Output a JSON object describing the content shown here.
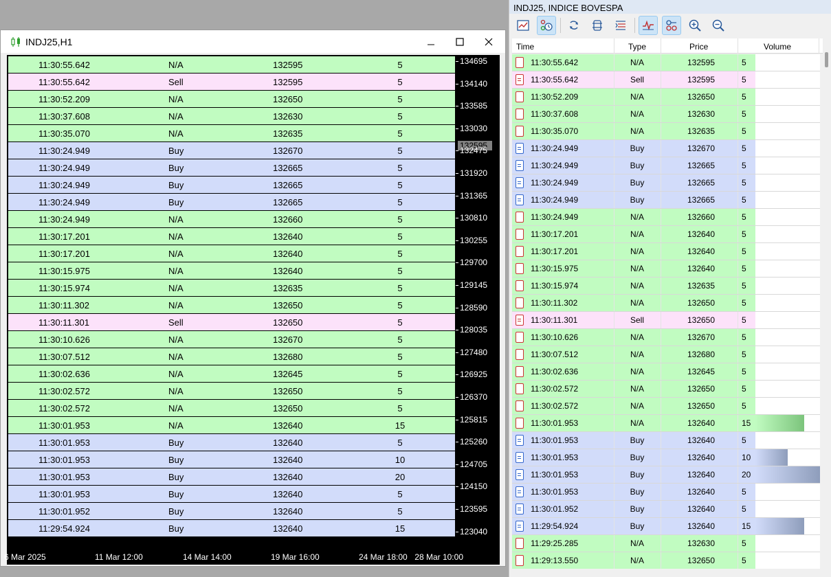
{
  "chart_window": {
    "title": "INDJ25,H1",
    "price_ticks": [
      "134695",
      "134140",
      "133585",
      "133030",
      "132475",
      "131920",
      "131365",
      "130810",
      "130255",
      "129700",
      "129145",
      "128590",
      "128035",
      "127480",
      "126925",
      "126370",
      "125815",
      "125260",
      "124705",
      "124150",
      "123595",
      "123040"
    ],
    "current_price": "132595",
    "time_ticks": [
      "6 Mar 2025",
      "11 Mar 12:00",
      "14 Mar 14:00",
      "19 Mar 16:00",
      "24 Mar 18:00",
      "28 Mar 10:00"
    ],
    "rows": [
      {
        "time": "11:30:55.642",
        "type": "N/A",
        "price": "132595",
        "volume": "5"
      },
      {
        "time": "11:30:55.642",
        "type": "Sell",
        "price": "132595",
        "volume": "5"
      },
      {
        "time": "11:30:52.209",
        "type": "N/A",
        "price": "132650",
        "volume": "5"
      },
      {
        "time": "11:30:37.608",
        "type": "N/A",
        "price": "132630",
        "volume": "5"
      },
      {
        "time": "11:30:35.070",
        "type": "N/A",
        "price": "132635",
        "volume": "5"
      },
      {
        "time": "11:30:24.949",
        "type": "Buy",
        "price": "132670",
        "volume": "5"
      },
      {
        "time": "11:30:24.949",
        "type": "Buy",
        "price": "132665",
        "volume": "5"
      },
      {
        "time": "11:30:24.949",
        "type": "Buy",
        "price": "132665",
        "volume": "5"
      },
      {
        "time": "11:30:24.949",
        "type": "Buy",
        "price": "132665",
        "volume": "5"
      },
      {
        "time": "11:30:24.949",
        "type": "N/A",
        "price": "132660",
        "volume": "5"
      },
      {
        "time": "11:30:17.201",
        "type": "N/A",
        "price": "132640",
        "volume": "5"
      },
      {
        "time": "11:30:17.201",
        "type": "N/A",
        "price": "132640",
        "volume": "5"
      },
      {
        "time": "11:30:15.975",
        "type": "N/A",
        "price": "132640",
        "volume": "5"
      },
      {
        "time": "11:30:15.974",
        "type": "N/A",
        "price": "132635",
        "volume": "5"
      },
      {
        "time": "11:30:11.302",
        "type": "N/A",
        "price": "132650",
        "volume": "5"
      },
      {
        "time": "11:30:11.301",
        "type": "Sell",
        "price": "132650",
        "volume": "5"
      },
      {
        "time": "11:30:10.626",
        "type": "N/A",
        "price": "132670",
        "volume": "5"
      },
      {
        "time": "11:30:07.512",
        "type": "N/A",
        "price": "132680",
        "volume": "5"
      },
      {
        "time": "11:30:02.636",
        "type": "N/A",
        "price": "132645",
        "volume": "5"
      },
      {
        "time": "11:30:02.572",
        "type": "N/A",
        "price": "132650",
        "volume": "5"
      },
      {
        "time": "11:30:02.572",
        "type": "N/A",
        "price": "132650",
        "volume": "5"
      },
      {
        "time": "11:30:01.953",
        "type": "N/A",
        "price": "132640",
        "volume": "15"
      },
      {
        "time": "11:30:01.953",
        "type": "Buy",
        "price": "132640",
        "volume": "5"
      },
      {
        "time": "11:30:01.953",
        "type": "Buy",
        "price": "132640",
        "volume": "10"
      },
      {
        "time": "11:30:01.953",
        "type": "Buy",
        "price": "132640",
        "volume": "20"
      },
      {
        "time": "11:30:01.953",
        "type": "Buy",
        "price": "132640",
        "volume": "5"
      },
      {
        "time": "11:30:01.952",
        "type": "Buy",
        "price": "132640",
        "volume": "5"
      },
      {
        "time": "11:29:54.924",
        "type": "Buy",
        "price": "132640",
        "volume": "15"
      }
    ]
  },
  "ts_window": {
    "title": "INDJ25, INDICE BOVESPA",
    "toolbar": [
      "chart-icon",
      "ticks-clock-icon",
      "sync-icon",
      "columns-icon",
      "list-icon",
      "pulse-icon",
      "circles-icon",
      "zoom-in-icon",
      "zoom-out-icon"
    ],
    "headers": {
      "time": "Time",
      "type": "Type",
      "price": "Price",
      "volume": "Volume"
    },
    "max_volume": 20,
    "colors": {
      "na": "#c1fcc1",
      "buy": "#d2dcfa",
      "sell": "#fce2fa",
      "na_bar": "#7cc47c",
      "buy_bar": "#8e9dbb"
    },
    "rows": [
      {
        "time": "11:30:55.642",
        "type": "N/A",
        "price": "132595",
        "volume": "5"
      },
      {
        "time": "11:30:55.642",
        "type": "Sell",
        "price": "132595",
        "volume": "5"
      },
      {
        "time": "11:30:52.209",
        "type": "N/A",
        "price": "132650",
        "volume": "5"
      },
      {
        "time": "11:30:37.608",
        "type": "N/A",
        "price": "132630",
        "volume": "5"
      },
      {
        "time": "11:30:35.070",
        "type": "N/A",
        "price": "132635",
        "volume": "5"
      },
      {
        "time": "11:30:24.949",
        "type": "Buy",
        "price": "132670",
        "volume": "5"
      },
      {
        "time": "11:30:24.949",
        "type": "Buy",
        "price": "132665",
        "volume": "5"
      },
      {
        "time": "11:30:24.949",
        "type": "Buy",
        "price": "132665",
        "volume": "5"
      },
      {
        "time": "11:30:24.949",
        "type": "Buy",
        "price": "132665",
        "volume": "5"
      },
      {
        "time": "11:30:24.949",
        "type": "N/A",
        "price": "132660",
        "volume": "5"
      },
      {
        "time": "11:30:17.201",
        "type": "N/A",
        "price": "132640",
        "volume": "5"
      },
      {
        "time": "11:30:17.201",
        "type": "N/A",
        "price": "132640",
        "volume": "5"
      },
      {
        "time": "11:30:15.975",
        "type": "N/A",
        "price": "132640",
        "volume": "5"
      },
      {
        "time": "11:30:15.974",
        "type": "N/A",
        "price": "132635",
        "volume": "5"
      },
      {
        "time": "11:30:11.302",
        "type": "N/A",
        "price": "132650",
        "volume": "5"
      },
      {
        "time": "11:30:11.301",
        "type": "Sell",
        "price": "132650",
        "volume": "5"
      },
      {
        "time": "11:30:10.626",
        "type": "N/A",
        "price": "132670",
        "volume": "5"
      },
      {
        "time": "11:30:07.512",
        "type": "N/A",
        "price": "132680",
        "volume": "5"
      },
      {
        "time": "11:30:02.636",
        "type": "N/A",
        "price": "132645",
        "volume": "5"
      },
      {
        "time": "11:30:02.572",
        "type": "N/A",
        "price": "132650",
        "volume": "5"
      },
      {
        "time": "11:30:02.572",
        "type": "N/A",
        "price": "132650",
        "volume": "5"
      },
      {
        "time": "11:30:01.953",
        "type": "N/A",
        "price": "132640",
        "volume": "15"
      },
      {
        "time": "11:30:01.953",
        "type": "Buy",
        "price": "132640",
        "volume": "5"
      },
      {
        "time": "11:30:01.953",
        "type": "Buy",
        "price": "132640",
        "volume": "10"
      },
      {
        "time": "11:30:01.953",
        "type": "Buy",
        "price": "132640",
        "volume": "20"
      },
      {
        "time": "11:30:01.953",
        "type": "Buy",
        "price": "132640",
        "volume": "5"
      },
      {
        "time": "11:30:01.952",
        "type": "Buy",
        "price": "132640",
        "volume": "5"
      },
      {
        "time": "11:29:54.924",
        "type": "Buy",
        "price": "132640",
        "volume": "15"
      },
      {
        "time": "11:29:25.285",
        "type": "N/A",
        "price": "132630",
        "volume": "5"
      },
      {
        "time": "11:29:13.550",
        "type": "N/A",
        "price": "132650",
        "volume": "5"
      }
    ]
  }
}
